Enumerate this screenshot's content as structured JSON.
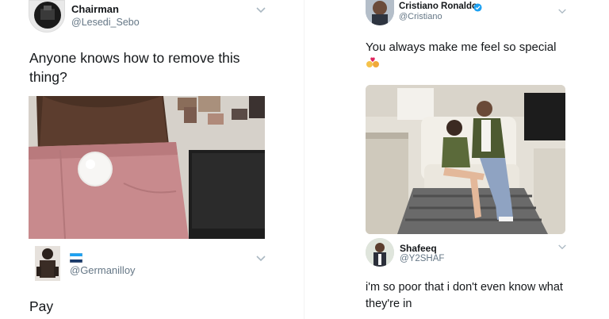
{
  "left": {
    "tweet1": {
      "name": "Chairman",
      "handle": "@Lesedi_Sebo",
      "text": "Anyone knows how to remove this thing?",
      "icons": [
        "avatar-photo",
        "chevron-down-icon",
        "attached-photo"
      ]
    },
    "tweet2": {
      "handle": "@Germanilloy",
      "text": "Pay",
      "icons": [
        "avatar-photo",
        "flag-icon",
        "chevron-down-icon"
      ]
    }
  },
  "right": {
    "tweet1": {
      "name": "Cristiano Ronaldo",
      "handle": "@Cristiano",
      "text": "You always make me feel so special",
      "verified": true,
      "icons": [
        "avatar-photo",
        "verified-badge-icon",
        "couple-emoji-icon",
        "chevron-down-icon",
        "attached-photo"
      ]
    },
    "tweet2": {
      "name": "Shafeeq",
      "handle": "@Y2SHAF",
      "text": "i'm so poor that i don't even know what they're in",
      "icons": [
        "avatar-photo",
        "chevron-down-icon"
      ]
    }
  },
  "colors": {
    "text": "#14171a",
    "handle": "#657786",
    "verified": "#1da1f2",
    "chevron": "#aab8c2"
  }
}
